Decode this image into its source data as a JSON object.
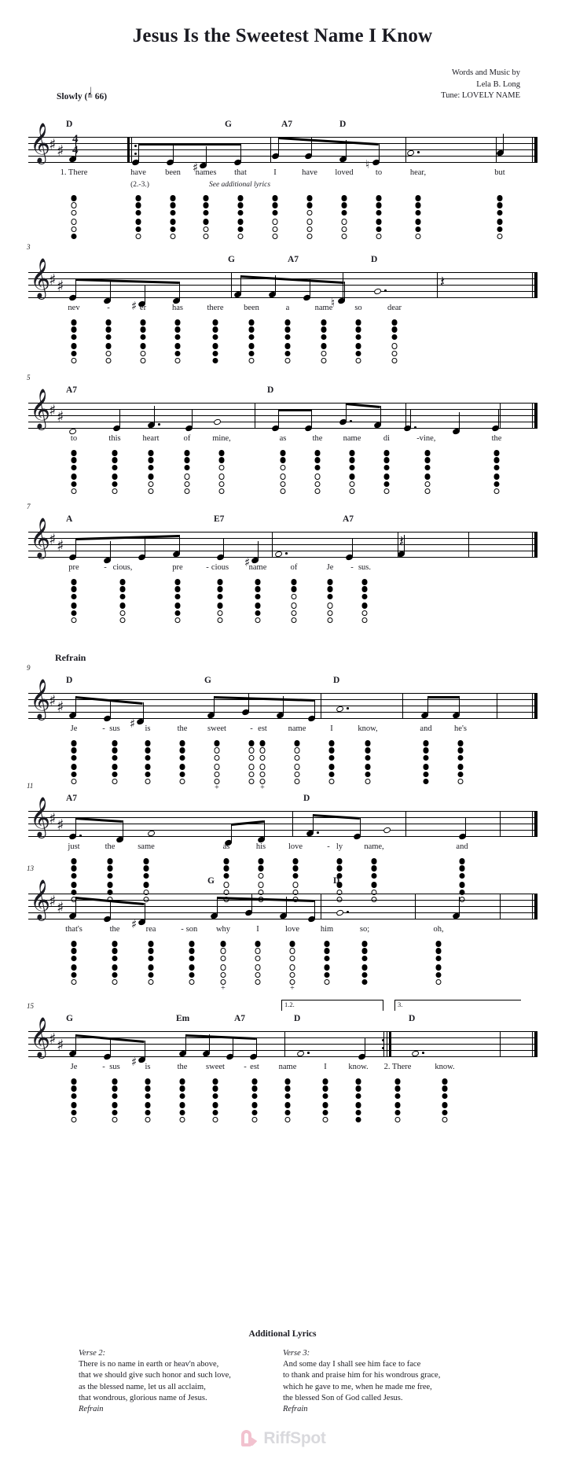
{
  "title": "Jesus Is the Sweetest Name I Know",
  "credits": {
    "line1": "Words and Music by",
    "line2": "Lela B. Long",
    "line3": "Tune: LOVELY NAME"
  },
  "tempo": {
    "word": "Slowly",
    "open": "(",
    "note": "♩",
    "equals": "= 66)"
  },
  "clef": "treble-clef",
  "key_signature": "2 sharps (D major)",
  "time_signature": {
    "top": "4",
    "bottom": "4"
  },
  "section_labels": {
    "refrain": "Refrain"
  },
  "systems": [
    {
      "number": "",
      "chords": [
        "D",
        "G",
        "A7",
        "D"
      ],
      "lyrics": [
        "1. There",
        "have",
        "been",
        "names",
        "that",
        "I",
        "have",
        "loved",
        "to",
        "hear,",
        "but"
      ],
      "cue": "(2.-3.)",
      "cue_note": "See additional lyrics"
    },
    {
      "number": "3",
      "chords": [
        "G",
        "A7",
        "D"
      ],
      "lyrics": [
        "nev",
        "-",
        "er",
        "has",
        "there",
        "been",
        "a",
        "name",
        "so",
        "dear"
      ]
    },
    {
      "number": "5",
      "chords": [
        "A7",
        "D"
      ],
      "lyrics": [
        "to",
        "this",
        "heart",
        "of",
        "mine,",
        "as",
        "the",
        "name",
        "di",
        "-",
        "vine,",
        "the"
      ]
    },
    {
      "number": "7",
      "chords": [
        "A",
        "E7",
        "A7"
      ],
      "lyrics": [
        "pre",
        "-",
        "cious,",
        "pre",
        "-",
        "cious",
        "name",
        "of",
        "Je",
        "-",
        "sus."
      ]
    },
    {
      "number": "9",
      "chords": [
        "D",
        "G",
        "D"
      ],
      "lyrics": [
        "Je",
        "-",
        "sus",
        "is",
        "the",
        "sweet",
        "-",
        "est",
        "name",
        "I",
        "know,",
        "and",
        "he's"
      ]
    },
    {
      "number": "11",
      "chords": [
        "A7",
        "D"
      ],
      "lyrics": [
        "just",
        "the",
        "same",
        "as",
        "his",
        "love",
        "-",
        "ly",
        "name,",
        "and"
      ]
    },
    {
      "number": "13",
      "chords": [
        "G",
        "D"
      ],
      "lyrics": [
        "that's",
        "the",
        "rea",
        "-",
        "son",
        "why",
        "I",
        "love",
        "him",
        "so;",
        "oh,"
      ]
    },
    {
      "number": "15",
      "chords": [
        "G",
        "Em",
        "A7",
        "D",
        "D"
      ],
      "voltas": [
        "1.2.",
        "3."
      ],
      "lyrics": [
        "Je",
        "-",
        "sus",
        "is",
        "the",
        "sweet",
        "-",
        "est",
        "name",
        "I",
        "know.",
        "2. There",
        "know."
      ]
    }
  ],
  "additional": {
    "heading": "Additional Lyrics",
    "verse2": {
      "header": "Verse 2:",
      "lines": [
        "There is no name in earth or heav'n above,",
        "that we should give such honor and such love,",
        "as the blessed name, let us all acclaim,",
        "that wondrous, glorious name of Jesus."
      ],
      "refrain": "Refrain"
    },
    "verse3": {
      "header": "Verse 3:",
      "lines": [
        "And some day I shall see him face to face",
        "to thank and praise him for his wondrous grace,",
        "which he gave to me, when he made me free,",
        "the blessed Son of God called Jesus."
      ],
      "refrain": "Refrain"
    }
  },
  "footer": {
    "brand": "RiffSpot",
    "brand_color": "#d9d9dd",
    "mark_color": "#f2c2cf"
  }
}
